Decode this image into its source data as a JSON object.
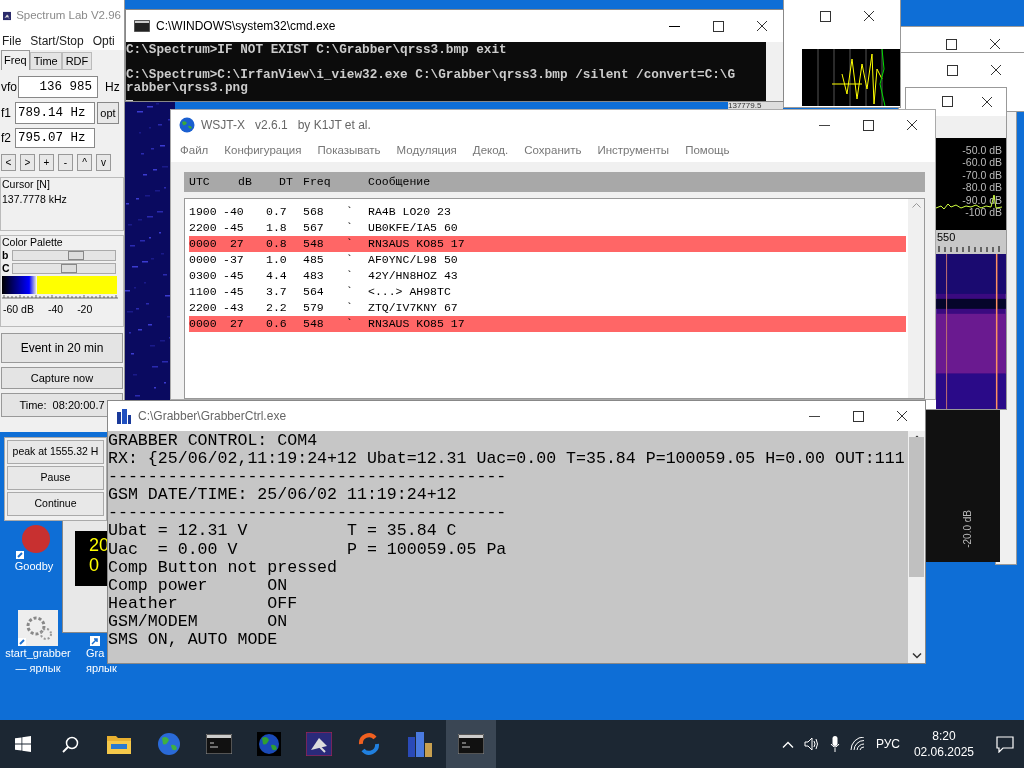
{
  "spectrum_lab": {
    "title": "Spectrum Lab V2.96",
    "menu": [
      "File",
      "Start/Stop",
      "Opti"
    ],
    "tabs": [
      {
        "label": "Freq",
        "selected": true
      },
      {
        "label": "Time",
        "selected": false
      },
      {
        "label": "RDF",
        "selected": false
      }
    ],
    "vfo": {
      "label": "vfo",
      "value": "136 985",
      "unit": "Hz"
    },
    "f1": {
      "label": "f1",
      "value": "789.14 Hz",
      "button": "opt"
    },
    "f2": {
      "label": "f2",
      "value": "795.07 Hz"
    },
    "step_buttons": [
      "<",
      ">",
      "+",
      "-",
      "^",
      "v"
    ],
    "cursor": {
      "title": "Cursor [N]",
      "value": "137.7778 kHz"
    },
    "palette": {
      "title": "Color Palette",
      "sliders": [
        {
          "label": "b",
          "level": 0.62
        },
        {
          "label": "C",
          "level": 0.55
        }
      ],
      "scale_labels": [
        "-60 dB",
        "-40",
        "-20"
      ]
    },
    "buttons": [
      "Event in 20 min",
      "Capture now",
      "Time:  08:20:00.7"
    ],
    "lower_buttons": [
      "peak at 1555.32 H",
      "Pause",
      "Continue"
    ],
    "readout": "137779.5"
  },
  "cmd": {
    "title": "C:\\WINDOWS\\system32\\cmd.exe",
    "lines": [
      {
        "text": "C:\\Spectrum>IF NOT EXIST C:\\Grabber\\qrss3.bmp exit",
        "gap_before": false
      },
      {
        "text": "C:\\Spectrum>C:\\IrfanView\\i_view32.exe C:\\Grabber\\qrss3.bmp /silent /convert=C:\\G",
        "gap_before": true
      },
      {
        "text": "rabber\\qrss3.png",
        "gap_before": false
      }
    ]
  },
  "wsjt": {
    "title": "WSJT-X   v2.6.1   by K1JT et al.",
    "menu": [
      "Файл",
      "Конфигурация",
      "Показывать",
      "Модуляция",
      "Декод.",
      "Сохранить",
      "Инструменты",
      "Помощь"
    ],
    "columns": [
      "UTC",
      "dB",
      "DT",
      "Freq",
      "Сообщение"
    ],
    "rows": [
      {
        "utc": "1900",
        "db": "-40",
        "dt": "0.7",
        "freq": "568",
        "mark": "`",
        "message": "RA4B LO20 23",
        "highlighted": false
      },
      {
        "utc": "2200",
        "db": "-45",
        "dt": "1.8",
        "freq": "567",
        "mark": "`",
        "message": "UB0KFE/IA5 60",
        "highlighted": false
      },
      {
        "utc": "0000",
        "db": " 27",
        "dt": "0.8",
        "freq": "548",
        "mark": "`",
        "message": "RN3AUS KO85 17",
        "highlighted": true
      },
      {
        "utc": "0000",
        "db": "-37",
        "dt": "1.0",
        "freq": "485",
        "mark": "`",
        "message": "AF0YNC/L98 50",
        "highlighted": false
      },
      {
        "utc": "0300",
        "db": "-45",
        "dt": "4.4",
        "freq": "483",
        "mark": "`",
        "message": "42Y/HN8HOZ 43",
        "highlighted": false
      },
      {
        "utc": "1100",
        "db": "-45",
        "dt": "3.7",
        "freq": "564",
        "mark": "`",
        "message": "<...> AH98TC",
        "highlighted": false
      },
      {
        "utc": "2200",
        "db": "-43",
        "dt": "2.2",
        "freq": "579",
        "mark": "`",
        "message": "ZTQ/IV7KNY 67",
        "highlighted": false
      },
      {
        "utc": "0000",
        "db": " 27",
        "dt": "0.6",
        "freq": "548",
        "mark": "`",
        "message": "RN3AUS KO85 17",
        "highlighted": true
      }
    ]
  },
  "grabber": {
    "title": "C:\\Grabber\\GrabberCtrl.exe",
    "lines": [
      "GRABBER CONTROL: COM4",
      "RX: {25/06/02,11:19:24+12 Ubat=12.31 Uac=0.00 T=35.84 P=100059.05 H=0.00 OUT:111",
      "----------------------------------------",
      "GSM DATE/TIME: 25/06/02 11:19:24+12",
      "----------------------------------------",
      "Ubat = 12.31 V          T = 35.84 C",
      "Uac  = 0.00 V           P = 100059.05 Pa",
      "Comp Button not pressed",
      "Comp power      ON",
      "Heather         OFF",
      "GSM/MODEM       ON",
      "SMS ON, AUTO MODE"
    ]
  },
  "clock_window": {
    "lines": [
      "20",
      "0"
    ]
  },
  "spectrum_window": {
    "db_labels": [
      "-50.0 dB",
      "-60.0 dB",
      "-70.0 dB",
      "-80.0 dB",
      "-90.0 dB",
      "-100 dB"
    ],
    "axis_label": "550",
    "side_label": "-20.0 dB"
  },
  "desktop_icons": [
    {
      "kind": "app",
      "lines": [
        "Goodby"
      ]
    },
    {
      "kind": "gear",
      "lines": [
        "start_grabber",
        "— ярлык"
      ]
    },
    {
      "kind": "arrow",
      "lines": [
        "Gra",
        "ярлык"
      ]
    }
  ],
  "taskbar": {
    "items": [
      {
        "kind": "start",
        "selected": false
      },
      {
        "kind": "search",
        "selected": false
      },
      {
        "kind": "folder",
        "selected": false
      },
      {
        "kind": "globe",
        "selected": false
      },
      {
        "kind": "terminal",
        "selected": false
      },
      {
        "kind": "globe-dark",
        "selected": false
      },
      {
        "kind": "satellite",
        "selected": false
      },
      {
        "kind": "sync",
        "selected": false
      },
      {
        "kind": "buildings",
        "selected": false
      },
      {
        "kind": "terminal",
        "selected": true
      }
    ],
    "language": "РУС",
    "time": "8:20",
    "date": "02.06.2025"
  }
}
